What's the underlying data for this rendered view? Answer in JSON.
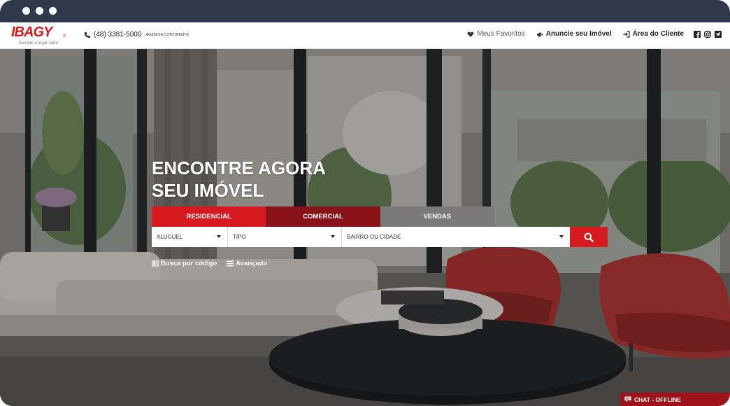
{
  "header": {
    "logo_text": "IBAGY",
    "logo_tagline": "Sempre o lugar certo",
    "phone": "(48) 3381-5000",
    "phone_label": "AGÊNCIA CONTINENTE",
    "nav": {
      "favorites": "Meus Favoritos",
      "announce": "Anuncie seu Imóvel",
      "client_area": "Área do Cliente"
    }
  },
  "hero": {
    "headline_line1": "ENCONTRE AGORA",
    "headline_line2": "SEU IMÓVEL",
    "tabs": [
      {
        "label": "RESIDENCIAL",
        "color": "#d71920"
      },
      {
        "label": "COMERCIAL",
        "color": "#8a1219"
      },
      {
        "label": "VENDAS",
        "color": "#7a7a7a"
      }
    ],
    "search": {
      "deal_type": "ALUGUEL",
      "property_type": "TIPO",
      "location": "BAIRRO OU CIDADE"
    },
    "quick_links": {
      "code_search": "Busca por código",
      "advanced": "Avançado"
    }
  },
  "chat": {
    "label": "CHAT - OFFLINE"
  },
  "colors": {
    "brand_red": "#d71920",
    "dark_red": "#8a1219",
    "gray_tab": "#7a7a7a",
    "chrome": "#2e3a4b"
  }
}
